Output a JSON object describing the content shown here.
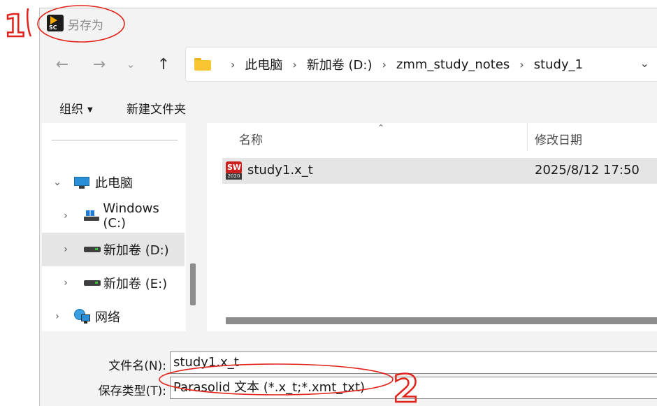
{
  "title": "另存为",
  "app_icon": {
    "name": "app-logo-icon",
    "label": "SC"
  },
  "nav": {
    "back_icon": "arrow-left-icon",
    "forward_icon": "arrow-right-icon",
    "recent_icon": "chevron-down-icon",
    "up_icon": "arrow-up-icon"
  },
  "breadcrumbs": [
    "此电脑",
    "新加卷 (D:)",
    "zmm_study_notes",
    "study_1"
  ],
  "toolbar": {
    "organize_label": "组织",
    "new_folder_label": "新建文件夹"
  },
  "navpane": {
    "items": [
      {
        "label": "此电脑",
        "icon": "computer-icon",
        "expanded": true
      },
      {
        "label": "Windows (C:)",
        "icon": "windows-drive-icon"
      },
      {
        "label": "新加卷 (D:)",
        "icon": "drive-icon",
        "selected": true
      },
      {
        "label": "新加卷 (E:)",
        "icon": "drive-icon"
      },
      {
        "label": "网络",
        "icon": "network-icon"
      }
    ]
  },
  "filelist": {
    "columns": {
      "name": "名称",
      "date": "修改日期"
    },
    "rows": [
      {
        "name": "study1.x_t",
        "date": "2025/8/12 17:50",
        "icon": "solidworks-file-icon",
        "icon_top": "SW",
        "icon_year": "2020"
      }
    ]
  },
  "form": {
    "filename_label": "文件名(N):",
    "filename_value": "study1.x_t",
    "filetype_label": "保存类型(T):",
    "filetype_value": "Parasolid 文本 (*.x_t;*.xmt_txt)"
  },
  "annotations": {
    "marker_1": "1",
    "marker_2": "2",
    "color": "#e0241b"
  }
}
